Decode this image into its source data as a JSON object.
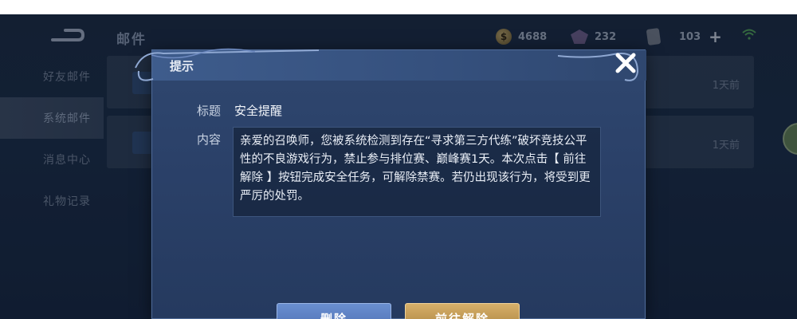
{
  "topbar": {
    "title": "邮件",
    "gold": "4688",
    "gems": "232",
    "cards": "103"
  },
  "sidebar": {
    "items": [
      {
        "label": "好友邮件"
      },
      {
        "label": "系统邮件"
      },
      {
        "label": "消息中心"
      },
      {
        "label": "礼物记录"
      }
    ],
    "active_index": 1
  },
  "mail_list": [
    {
      "time": "1天前"
    },
    {
      "time": "1天前"
    }
  ],
  "dialog": {
    "title": "提示",
    "subject_label": "标题",
    "subject": "安全提醒",
    "content_label": "内容",
    "content": "亲爱的召唤师，您被系统检测到存在“寻求第三方代练”破坏竞技公平性的不良游戏行为，禁止参与排位赛、巅峰赛1天。本次点击【 前往解除 】按钮完成安全任务，可解除禁赛。若仍出现该行为，将受到更严厉的处罚。",
    "delete_label": "删除",
    "go_label": "前往解除"
  },
  "colors": {
    "dialog_bg": "#2b4169",
    "delete_button": "#5a7dc0",
    "go_button": "#c29a52"
  }
}
